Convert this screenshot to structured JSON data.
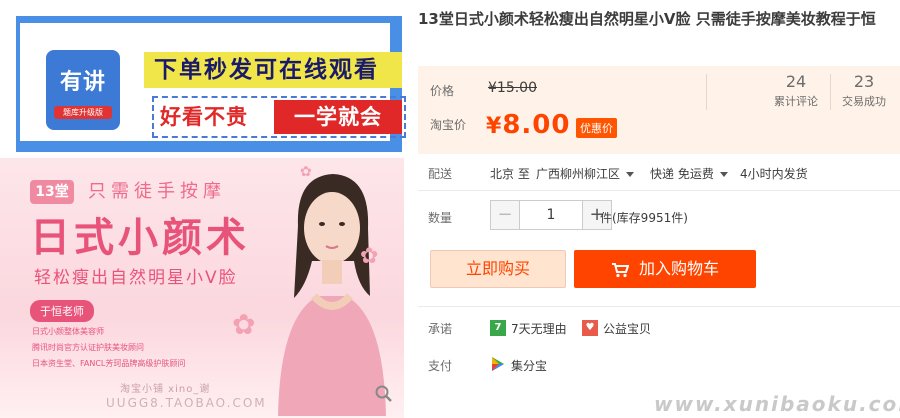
{
  "product_image": {
    "logo_text": "有讲",
    "logo_sub": "题库升级版",
    "slogan_line1": "下单秒发可在线观看",
    "slogan_line2_a": "好看不贵",
    "slogan_line2_b": "一学就会",
    "poster": {
      "tag": "13堂",
      "subtitle": "只需徒手按摩",
      "title": "日式小颜术",
      "tagline": "轻松瘦出自然明星小V脸",
      "teacher": "于恒老师",
      "bullets": [
        "日式小颜整体美容师",
        "腾讯时尚官方认证护肤美妆顾问",
        "日本资生堂、FANCL芳珂品牌高级护肤顾问"
      ],
      "watermark_top": "淘宝小铺 xino_谢",
      "watermark_bottom": "UUGG8.TAOBAO.COM"
    }
  },
  "product": {
    "title": "13堂日式小颜术轻松瘦出自然明星小V脸 只需徒手按摩美妆教程于恒",
    "price_label": "价格",
    "original_price": "¥15.00",
    "taobao_price_label": "淘宝价",
    "currency": "¥",
    "current_price": "8.00",
    "promo_badge": "优惠价",
    "stats": [
      {
        "number": "24",
        "label": "累计评论"
      },
      {
        "number": "23",
        "label": "交易成功"
      }
    ]
  },
  "delivery": {
    "label": "配送",
    "from": "北京 至",
    "to": "广西柳州柳江区",
    "method": "快递 免运费",
    "ship_time": "4小时内发货"
  },
  "quantity": {
    "label": "数量",
    "minus": "−",
    "value": "1",
    "plus": "+",
    "stock": "件(库存9951件)"
  },
  "actions": {
    "buy_now": "立即购买",
    "add_to_cart": "加入购物车"
  },
  "promise": {
    "label": "承诺",
    "items": [
      "7天无理由",
      "公益宝贝"
    ]
  },
  "payment": {
    "label": "支付",
    "method": "集分宝"
  },
  "footer_watermark": "www.xunibaoku.com",
  "colors": {
    "accent": "#ff4400",
    "price_bg": "#fff2e8",
    "banner_blue": "#4a8fe6",
    "poster_pink": "#e8537a"
  }
}
